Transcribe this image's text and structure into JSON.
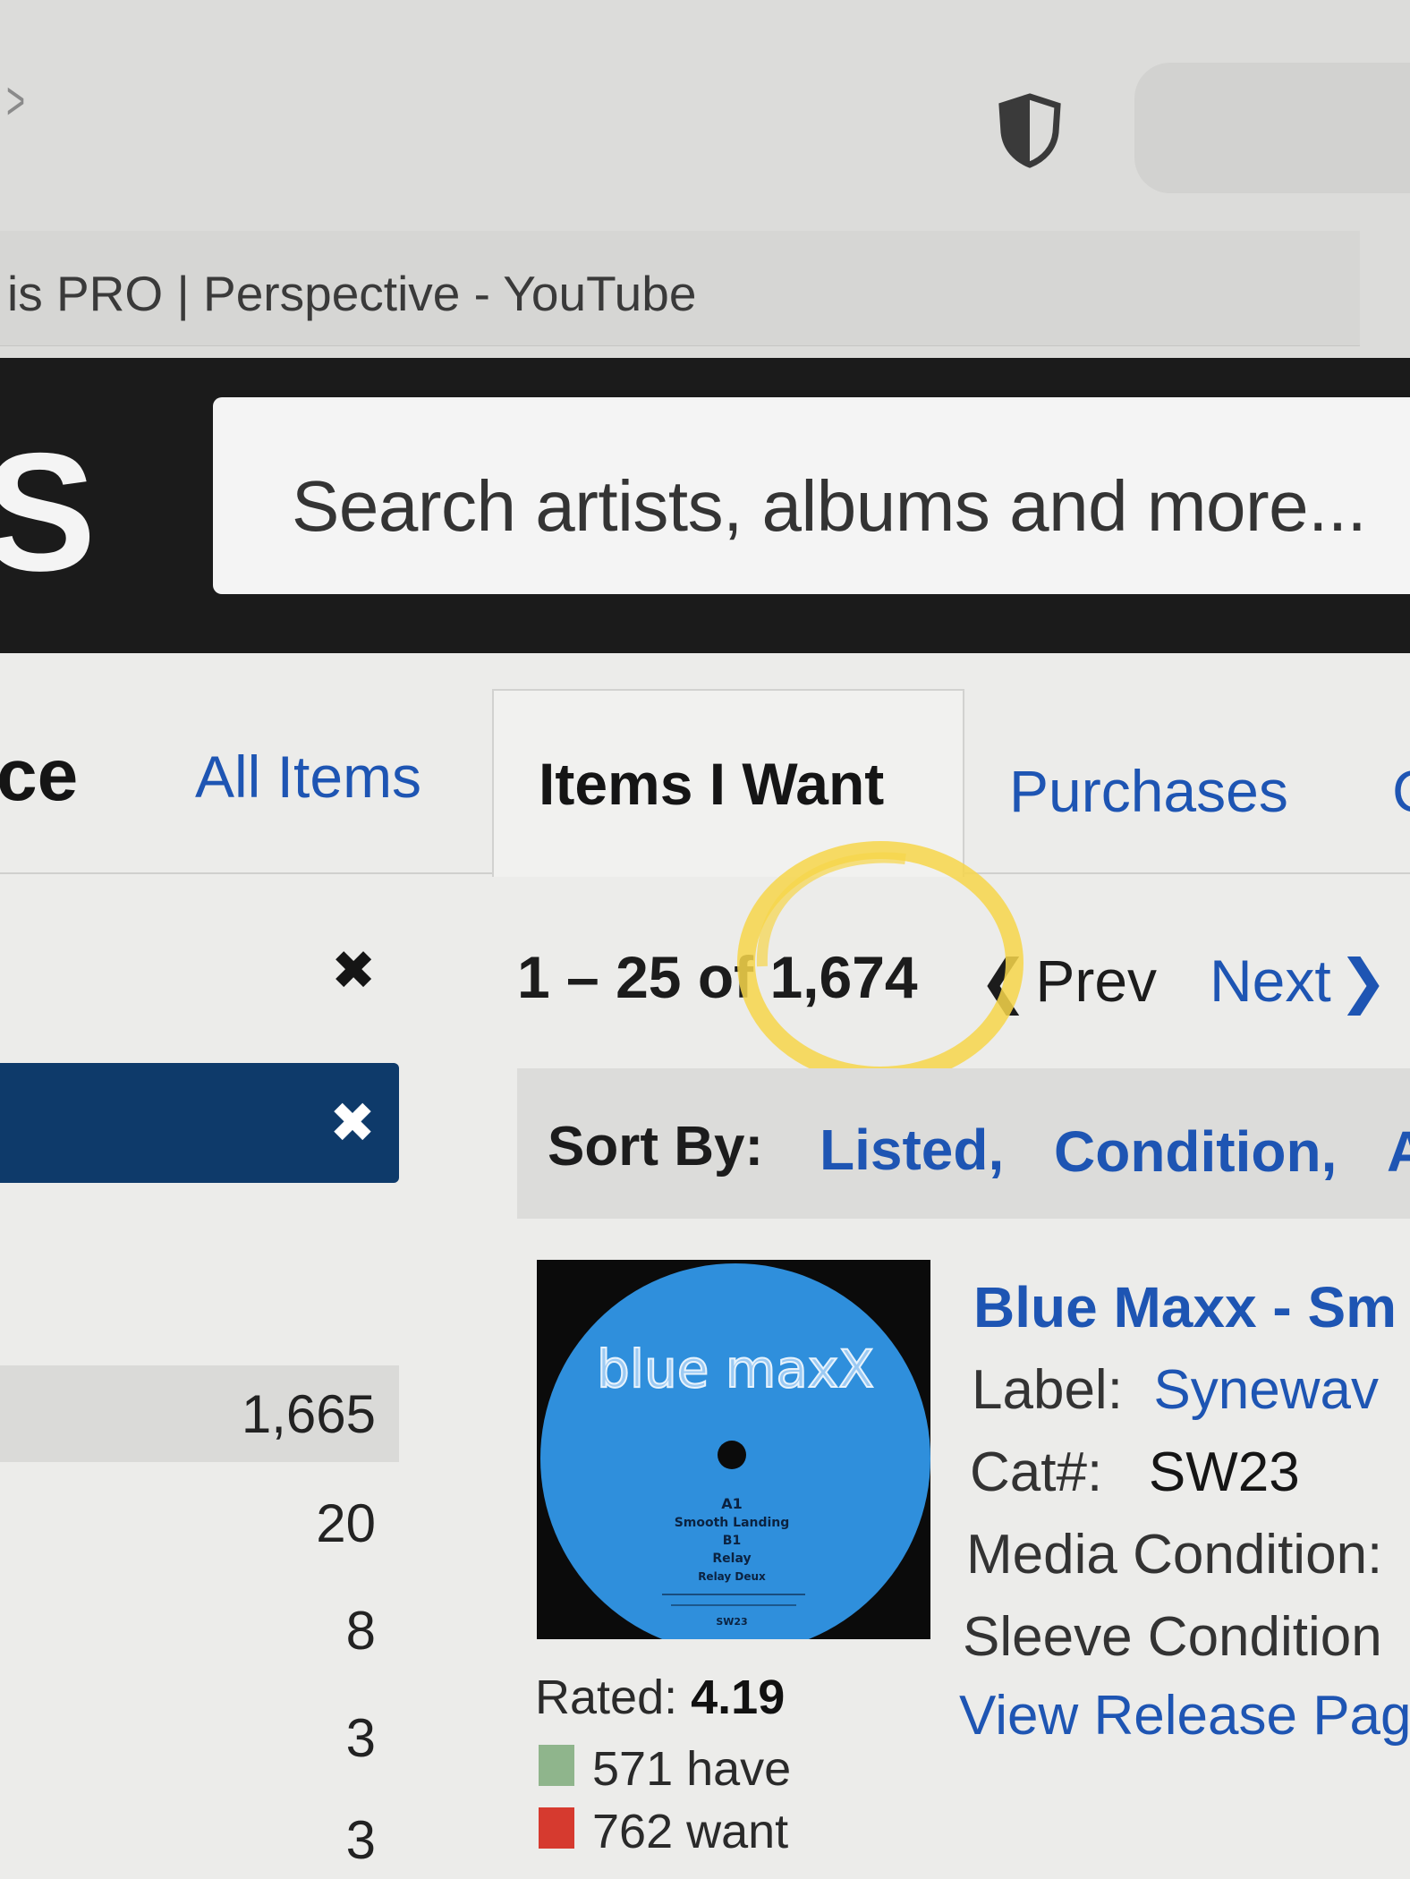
{
  "browser": {
    "tab_title": "is PRO | Perspective - YouTube",
    "icons": {
      "back": "chevron-right-icon",
      "shield": "shield-icon"
    }
  },
  "header": {
    "logo_partial": "S",
    "search_placeholder": "Search artists, albums and more..."
  },
  "nav": {
    "section_partial": "ce",
    "tabs": [
      {
        "label": "All Items",
        "active": false
      },
      {
        "label": "Items I Want",
        "active": true
      },
      {
        "label": "Purchases",
        "active": false
      },
      {
        "label": "C",
        "active": false
      }
    ]
  },
  "filters": {
    "clear_icon": "close-icon",
    "active_filter_clear_icon": "close-icon"
  },
  "pagination": {
    "range": "1 – 25 of 1,674",
    "prev": "Prev",
    "next": "Next"
  },
  "sort": {
    "label": "Sort By:",
    "options": [
      "Listed,",
      "Condition,",
      "A"
    ]
  },
  "facets": {
    "counts": [
      "1,665",
      "20",
      "8",
      "3",
      "3"
    ]
  },
  "colors": {
    "link": "#1e55b3",
    "header_bg": "#1b1b1b",
    "active_filter_bg": "#0e3a6a",
    "have_square": "#8fb58c",
    "want_square": "#d63a2f",
    "highlight": "#f7d64a"
  },
  "item": {
    "cover_text": {
      "brand": "blue maxX",
      "a_side": "A1",
      "a_track": "Smooth Landing",
      "b_side": "B1",
      "b_track1": "Relay",
      "b_track2": "Relay Deux",
      "cat": "SW23"
    },
    "title": "Blue Maxx - Sm",
    "label_key": "Label:",
    "label_value": "Synewav",
    "cat_key": "Cat#:",
    "cat_value": "SW23",
    "media_condition": "Media Condition:",
    "sleeve_condition": "Sleeve Condition",
    "view_release": "View Release Pag",
    "rated_label": "Rated:",
    "rated_value": "4.19",
    "have": "571 have",
    "want": "762 want"
  }
}
